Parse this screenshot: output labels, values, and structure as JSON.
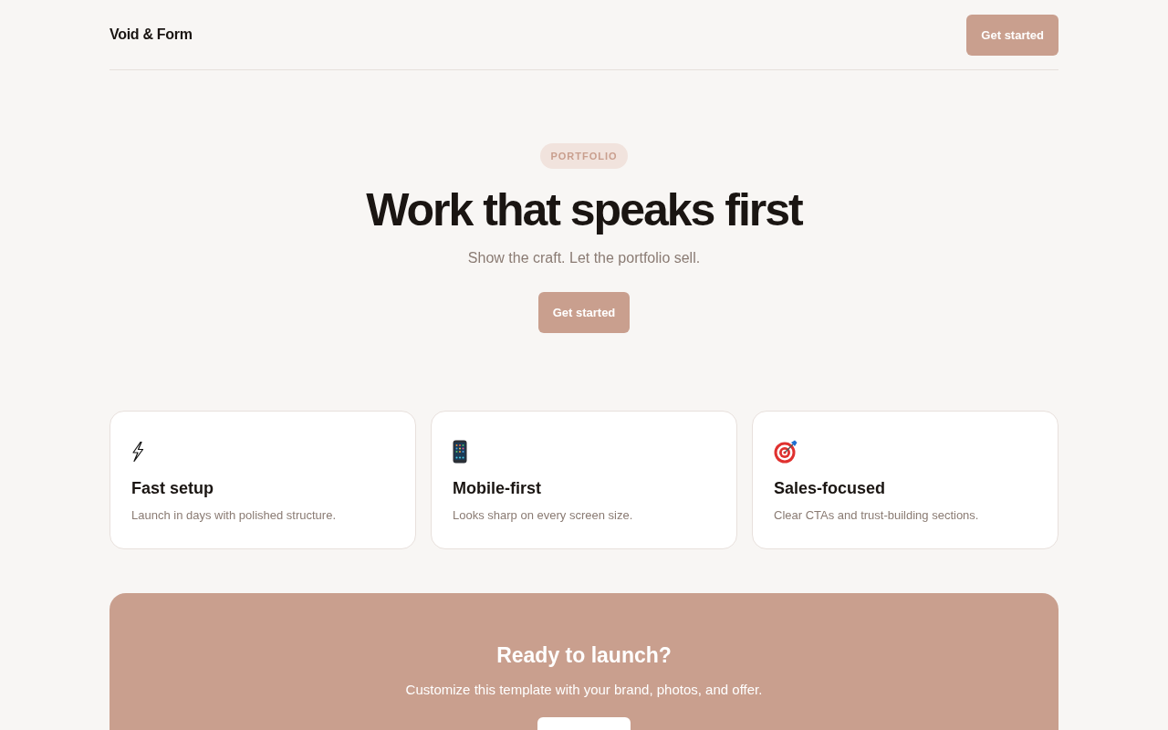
{
  "header": {
    "logo": "Void & Form",
    "button": "Get started"
  },
  "hero": {
    "badge": "PORTFOLIO",
    "title": "Work that speaks first",
    "subtitle": "Show the craft. Let the portfolio sell.",
    "button": "Get started"
  },
  "features": [
    {
      "title": "Fast setup",
      "text": "Launch in days with polished structure."
    },
    {
      "title": "Mobile-first",
      "text": "Looks sharp on every screen size."
    },
    {
      "title": "Sales-focused",
      "text": "Clear CTAs and trust-building sections."
    }
  ],
  "cta": {
    "title": "Ready to launch?",
    "text": "Customize this template with your brand, photos, and offer."
  }
}
